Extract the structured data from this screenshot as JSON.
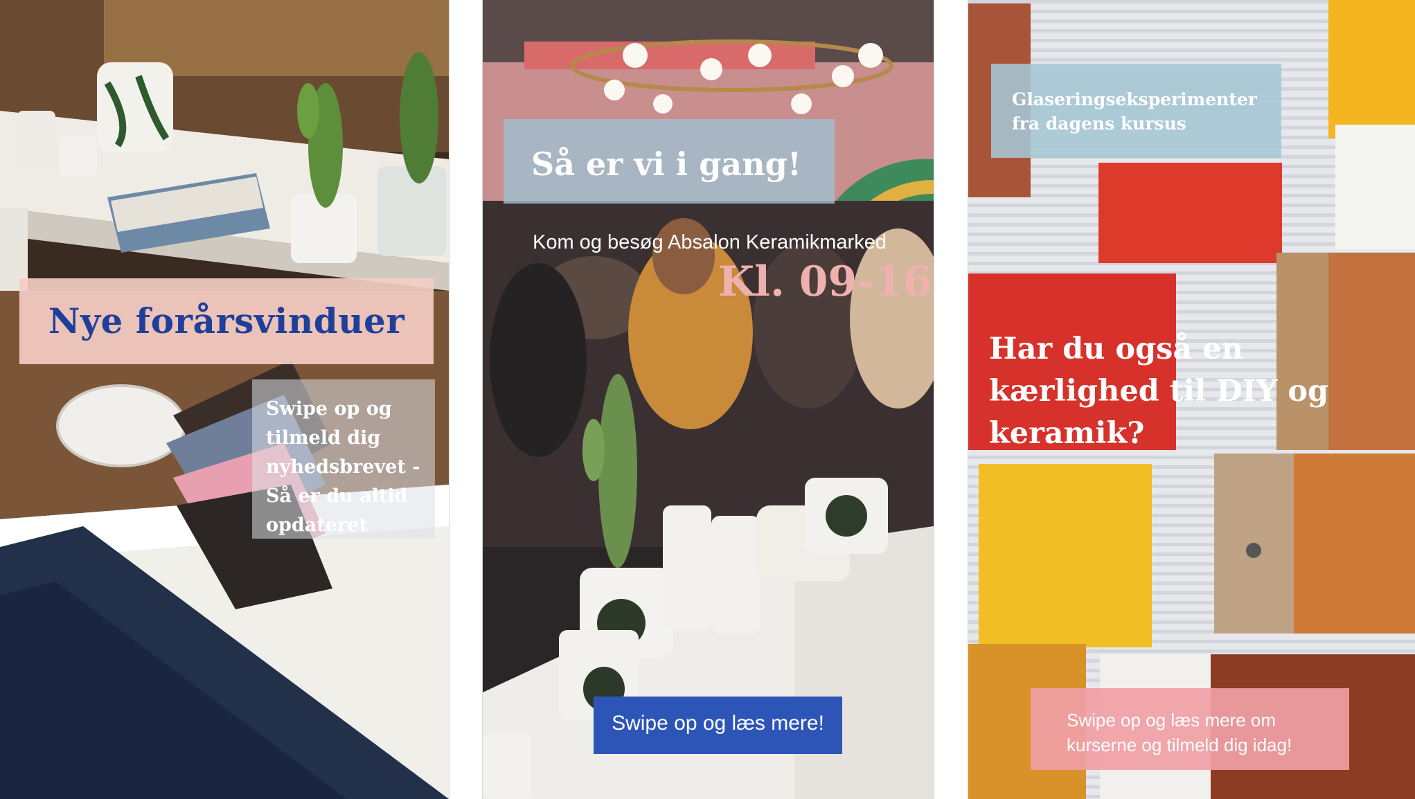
{
  "stories": [
    {
      "title": "Nye forårsvinduer",
      "swipe_text": "Swipe op og tilmeld dig nyhedsbrevet - Så er du altid opdateret"
    },
    {
      "title": "Så er vi i gang!",
      "subtitle": "Kom og besøg Absalon Keramikmarked",
      "time": "Kl. 09-16",
      "button_label": "Swipe op og læs mere!"
    },
    {
      "title": "Glaseringseksperimenter fra dagens kursus",
      "question": "Har du også en kærlighed til DIY og keramik?",
      "button_label": "Swipe op og læs mere om kurserne og tilmeld dig idag!"
    }
  ],
  "colors": {
    "story1_title": "#1f3f9a",
    "story1_title_box": "#f4cdc3",
    "story2_title_box": "#a0becd",
    "story2_time": "#efb0b0",
    "story2_button": "#2d55b8",
    "story3_title_box": "#a5c6d4",
    "story3_button": "#f0a0a5"
  }
}
